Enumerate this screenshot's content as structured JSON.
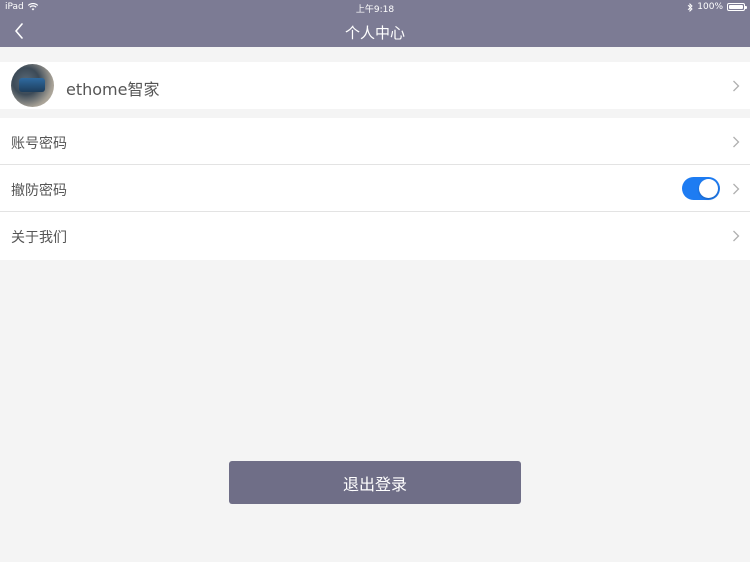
{
  "status_bar": {
    "device": "iPad",
    "time": "上午9:18",
    "battery": "100%"
  },
  "nav": {
    "title": "个人中心",
    "back_icon": "chevron-left-icon"
  },
  "profile": {
    "name": "ethome智家",
    "avatar_icon": "avatar"
  },
  "settings": {
    "items": [
      {
        "label": "账号密码"
      },
      {
        "label": "撤防密码",
        "toggle_on": true
      },
      {
        "label": "关于我们"
      }
    ]
  },
  "logout": {
    "label": "退出登录"
  },
  "colors": {
    "header_bg": "#7c7b94",
    "toggle_on": "#1e7cf2",
    "logout_bg": "#6f6e87",
    "page_bg": "#f4f4f4"
  }
}
